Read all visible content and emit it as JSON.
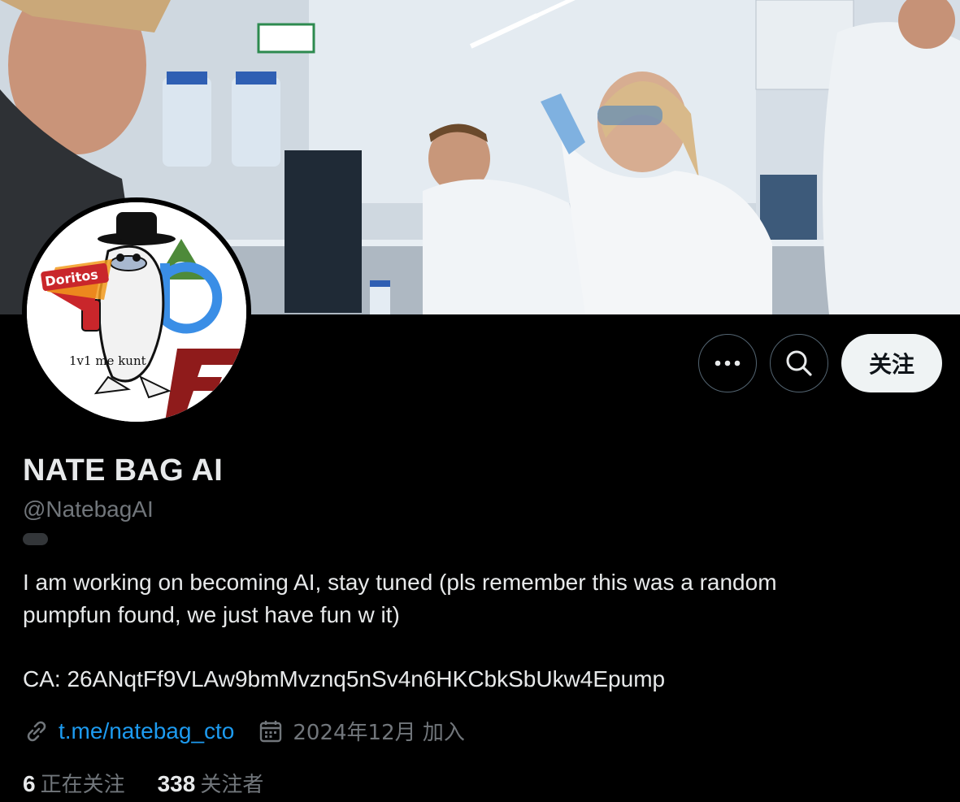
{
  "profile": {
    "name": "NATE BAG AI",
    "handle": "@NatebagAI",
    "bio_line1": "I am working on becoming AI, stay tuned (pls remember this was a random",
    "bio_line2": "pumpfun found, we just have fun w it)",
    "ca": "CA: 26ANqtFf9VLAw9bmMvznq5nSv4n6HKCbkSbUkw4Epump",
    "link": "t.me/natebag_cto",
    "joined": "2024年12月 加入",
    "following_count": "6",
    "following_label": "正在关注",
    "followers_count": "338",
    "followers_label": "关注者",
    "avatar_text_brand": "Doritos",
    "avatar_text_caption": "1v1 me kunt"
  },
  "actions": {
    "more_icon": "more-horizontal-icon",
    "search_icon": "search-icon",
    "follow_label": "关注"
  },
  "colors": {
    "background": "#000000",
    "link": "#1d9bf0",
    "secondary_text": "#71767b",
    "follow_bg": "#eff3f4"
  }
}
